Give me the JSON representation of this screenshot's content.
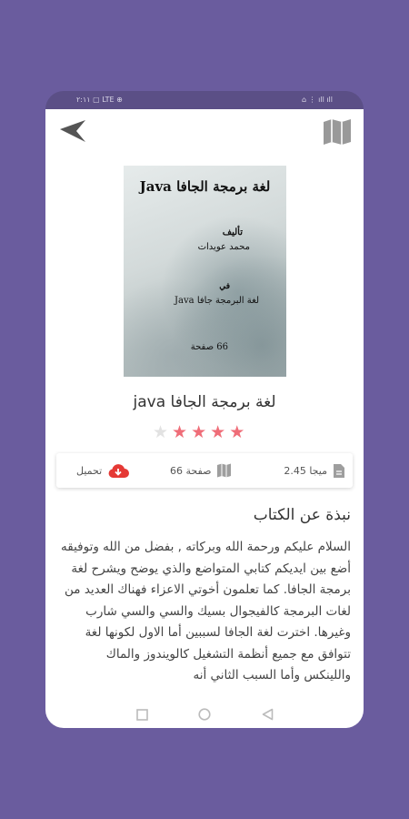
{
  "status_bar": {
    "left": "٢:١١ ▢ LTE ⊕",
    "right": "⌂ ⋮ ıll ıll"
  },
  "book": {
    "title": "لغة برمجة الجافا java",
    "rating": 4,
    "rating_max": 5,
    "cover": {
      "title": "لغة برمجة الجافا Java",
      "by": "تأليف",
      "author": "محمد عويدات",
      "in": "في",
      "subtitle": "لغة البرمجة جافا Java",
      "pages": "66 صفحة"
    }
  },
  "info": {
    "size_label": "2.45 ميجا",
    "pages_label": "66 صفحة",
    "download_label": "تحميل"
  },
  "about": {
    "heading": "نبذة عن الكتاب",
    "text": "السلام عليكم ورحمة الله وبركاته , بفضل من الله وتوفيقه أضع بين ايديكم كتابي المتواضع والذي يوضح ويشرح لغة برمجة الجافا. كما تعلمون أخوتي الاعزاء فهناك العديد من لغات البرمجة كالفيجوال بسيك والسي والسي شارب وغيرها. اخترت لغة الجافا لسببين أما الاول لكونها لغة تتوافق مع جميع أنظمة التشغيل كالويندوز والماك واللينكس وأما السبب الثاني أنه"
  },
  "colors": {
    "background": "#6a5c9e",
    "star_on": "#ef6d78",
    "download": "#e53935"
  }
}
